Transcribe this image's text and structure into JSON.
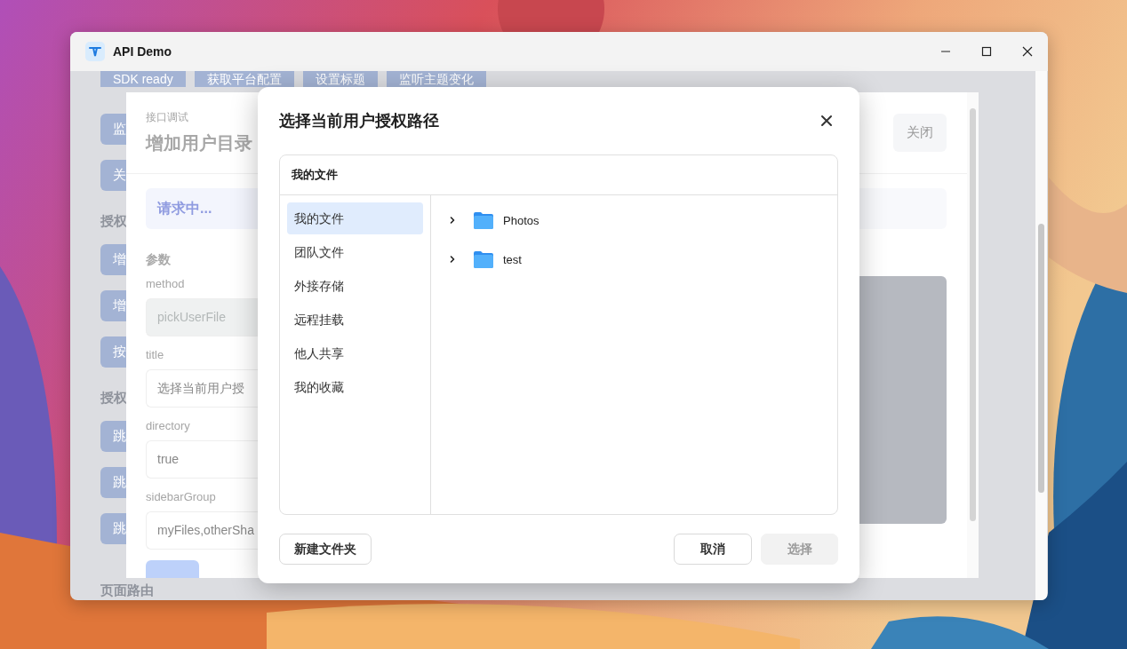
{
  "window": {
    "title": "API Demo"
  },
  "page": {
    "top_buttons": [
      "SDK ready",
      "获取平台配置",
      "设置标题",
      "监听主题变化"
    ],
    "side_list": [
      {
        "kind": "button",
        "label": "监"
      },
      {
        "kind": "button",
        "label": "关"
      },
      {
        "kind": "heading",
        "label": "授权"
      },
      {
        "kind": "button",
        "label": "增"
      },
      {
        "kind": "button",
        "label": "增"
      },
      {
        "kind": "button",
        "label": "按"
      },
      {
        "kind": "heading",
        "label": "授权"
      },
      {
        "kind": "button",
        "label": "跳"
      },
      {
        "kind": "button",
        "label": "跳"
      },
      {
        "kind": "button",
        "label": "跳"
      },
      {
        "kind": "heading",
        "label": "页面路由"
      }
    ]
  },
  "debug_dialog": {
    "caption": "接口调试",
    "title": "增加用户目录",
    "close_button": "关闭",
    "status": "请求中...",
    "params_heading": "参数",
    "fields": [
      {
        "label": "method",
        "value": "pickUserFile",
        "disabled": true
      },
      {
        "label": "title",
        "value": "选择当前用户授",
        "disabled": false
      },
      {
        "label": "directory",
        "value": "true",
        "disabled": false
      },
      {
        "label": "sidebarGroup",
        "value": "myFiles,otherSha",
        "disabled": false
      }
    ]
  },
  "dialog": {
    "title": "选择当前用户授权路径",
    "breadcrumb": "我的文件",
    "sidebar": [
      {
        "label": "我的文件",
        "selected": true
      },
      {
        "label": "团队文件",
        "selected": false
      },
      {
        "label": "外接存储",
        "selected": false
      },
      {
        "label": "远程挂载",
        "selected": false
      },
      {
        "label": "他人共享",
        "selected": false
      },
      {
        "label": "我的收藏",
        "selected": false
      }
    ],
    "tree": [
      {
        "label": "Photos",
        "expanded": false
      },
      {
        "label": "test",
        "expanded": false
      }
    ],
    "new_folder_button": "新建文件夹",
    "cancel_button": "取消",
    "select_button": {
      "label": "选择",
      "disabled": true
    }
  }
}
